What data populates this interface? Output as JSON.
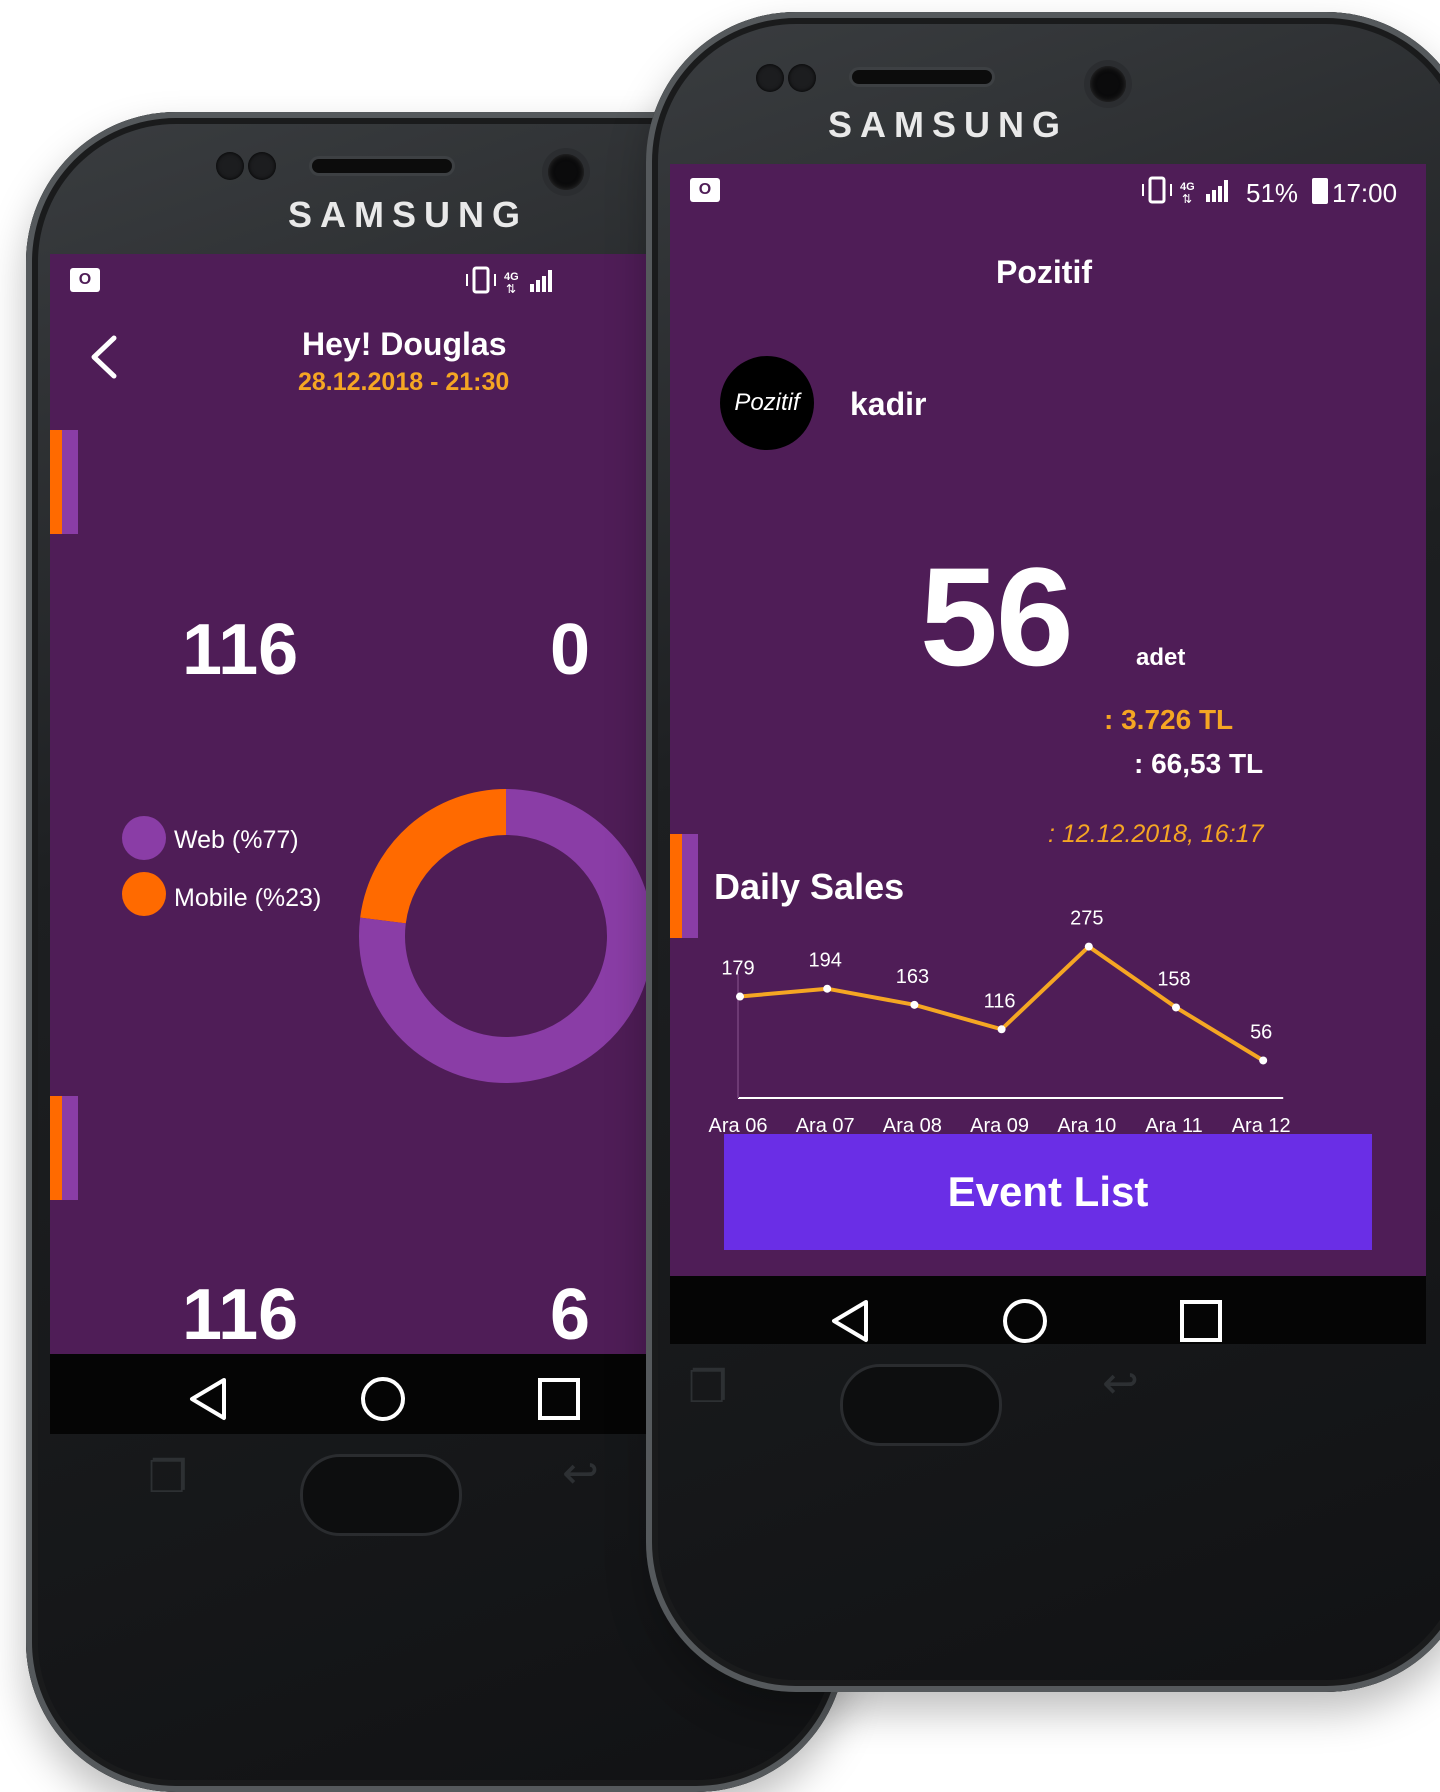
{
  "brand": "SAMSUNG",
  "colors": {
    "screen_bg": "#4f1d57",
    "accent_orange": "#ff6a00",
    "accent_purple": "#8a3da6",
    "gold_text": "#f5a623",
    "button": "#6a2ee6",
    "chart_line": "#f5a623"
  },
  "left_screen": {
    "status_icons": "vibrate, 4G, signal",
    "greeting": "Hey! Douglas",
    "datetime": "28.12.2018 - 21:30",
    "stat_top_left": "116",
    "stat_top_right": "0",
    "stat_bottom_left": "116",
    "stat_bottom_right": "6",
    "legend": [
      {
        "label": "Web (%77)",
        "color": "#8a3da6"
      },
      {
        "label": "Mobile (%23)",
        "color": "#ff6a00"
      }
    ]
  },
  "right_screen": {
    "status": {
      "battery": "51%",
      "time": "17:00"
    },
    "title": "Pozitif",
    "logo_text": "Pozitif",
    "user": "kadir",
    "count": "56",
    "count_unit": "adet",
    "total_amount": ": 3.726 TL",
    "average_amount": ": 66,53 TL",
    "last_date": ": 12.12.2018, 16:17",
    "daily_sales_title": "Daily Sales",
    "event_button": "Event List"
  },
  "chart_data": [
    {
      "type": "pie",
      "categories": [
        "Web",
        "Mobile"
      ],
      "values": [
        77,
        23
      ],
      "legend": [
        "Web (%77)",
        "Mobile (%23)"
      ],
      "style": "donut"
    },
    {
      "type": "line",
      "title": "Daily Sales",
      "categories": [
        "Ara 06",
        "Ara 07",
        "Ara 08",
        "Ara 09",
        "Ara 10",
        "Ara 11",
        "Ara 12"
      ],
      "values": [
        179,
        194,
        163,
        116,
        275,
        158,
        56
      ],
      "xlabel": "",
      "ylabel": "",
      "ylim": [
        0,
        300
      ],
      "grid": false
    }
  ]
}
